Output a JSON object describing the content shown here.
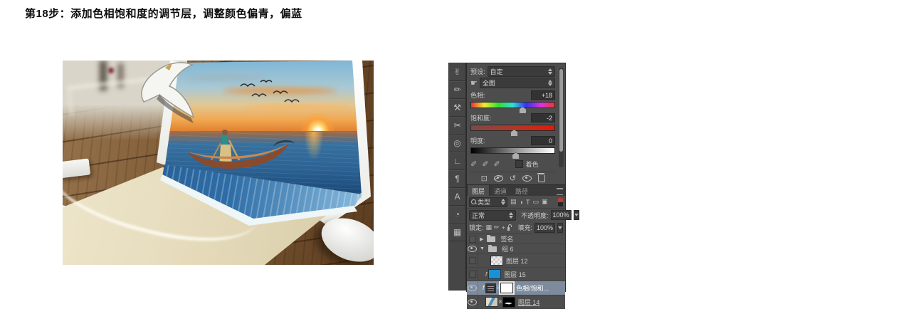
{
  "title": "第18步：添加色相饱和度的调节层，调整颜色偏青，偏蓝",
  "artwork": {
    "description": "Photo composite: a sunset ocean scene with a woman and a canoe spills out of a white laptop screen onto its sandy keyboard, on a wooden desk with a white mouse and seagulls"
  },
  "toolbar": {
    "tools": [
      {
        "name": "hand-tool",
        "glyph": "✌"
      },
      {
        "name": "brush-tool",
        "glyph": "✏"
      },
      {
        "name": "stamp-tool",
        "glyph": "⚒"
      },
      {
        "name": "cut-tool",
        "glyph": "✂"
      },
      {
        "name": "dodge-tool",
        "glyph": "◎"
      },
      {
        "name": "pen-tool",
        "glyph": "∟"
      },
      {
        "name": "paragraph-tool",
        "glyph": "¶"
      },
      {
        "name": "type-tool",
        "glyph": "A"
      },
      {
        "name": "sponge-tool",
        "glyph": "◔"
      },
      {
        "name": "grid-tool",
        "glyph": "▦"
      }
    ]
  },
  "properties_panel": {
    "preset_label": "预设:",
    "preset_value": "自定",
    "channel_value": "全图",
    "hue_label": "色相:",
    "hue_value": "+18",
    "saturation_label": "饱和度:",
    "saturation_value": "-2",
    "lightness_label": "明度:",
    "lightness_value": "0",
    "colorize_label": "着色",
    "icons": {
      "targeted_adjust": "☛",
      "eyedropper": "✐",
      "eyedropper_plus": "✐",
      "eyedropper_minus": "✐",
      "clip_to_layer": "⊡",
      "reset": "↺"
    }
  },
  "layers_panel": {
    "tabs": [
      {
        "label": "图层"
      },
      {
        "label": "通道"
      },
      {
        "label": "路径"
      }
    ],
    "filter_type_label": "类型",
    "filter_icons": {
      "pixel": "▤",
      "adjustment": "◑",
      "type": "T",
      "shape": "▭",
      "smart": "▣"
    },
    "blend_mode_value": "正常",
    "opacity_label": "不透明度:",
    "opacity_value": "100%",
    "lock_label": "锁定:",
    "lock_icons": {
      "transparent": "▦",
      "pixels": "✏",
      "position": "+"
    },
    "fill_label": "填充:",
    "fill_value": "100%",
    "layers": [
      {
        "name": "签名",
        "type": "group-collapsed",
        "visible": false
      },
      {
        "name": "组 6",
        "type": "group-expanded",
        "visible": true
      },
      {
        "name": "图层 12",
        "type": "transparent-layer",
        "visible": false
      },
      {
        "name": "图层 15",
        "type": "color-layer-clipped",
        "visible": false
      },
      {
        "name": "色相/饱和...",
        "type": "adjustment-layer-clipped",
        "visible": true,
        "selected": true
      },
      {
        "name": "图层 14",
        "type": "image-layer-with-mask",
        "visible": true
      }
    ]
  },
  "colors": {
    "panel_bg": "#4d4d4d",
    "selected_layer_bg": "#7d8b9d",
    "layer15_thumb_blue": "#1a90d9",
    "filter_toggle_red": "#b04038"
  }
}
